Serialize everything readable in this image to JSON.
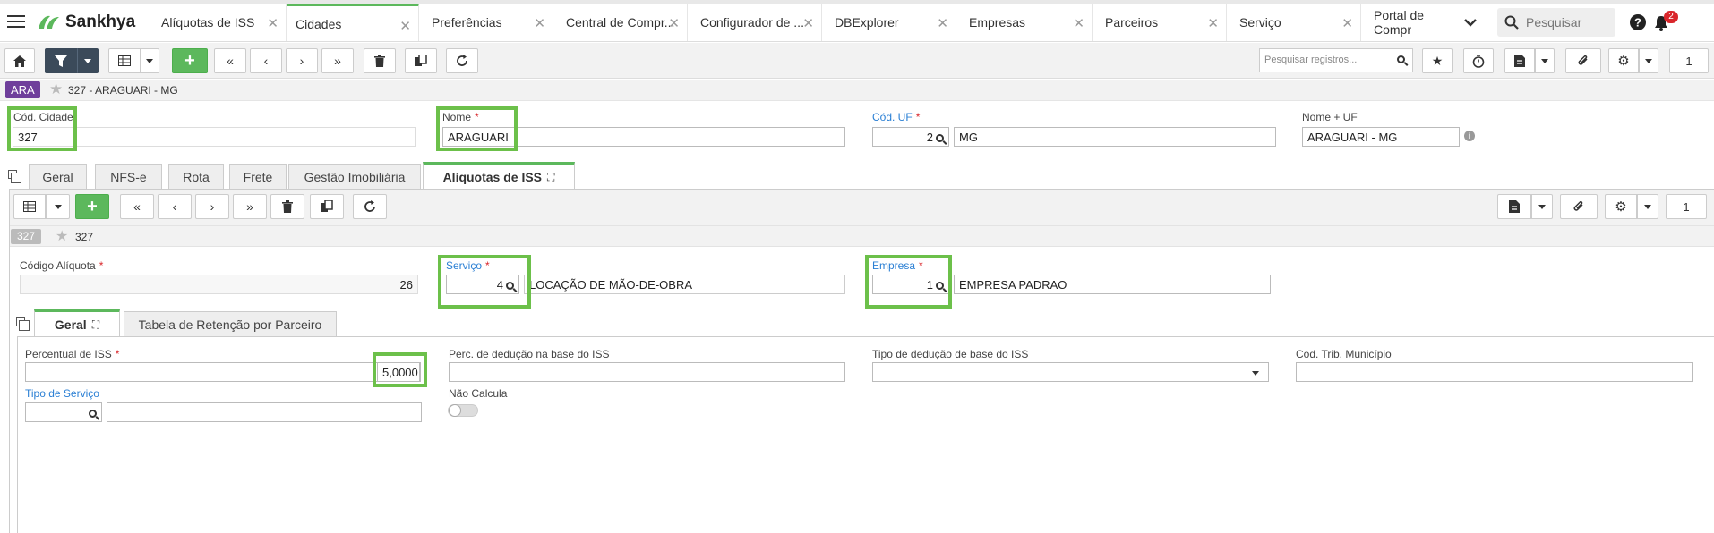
{
  "app": {
    "name": "Sankhya"
  },
  "tabs": [
    {
      "label": "Alíquotas de ISS"
    },
    {
      "label": "Cidades"
    },
    {
      "label": "Preferências"
    },
    {
      "label": "Central de Compr..."
    },
    {
      "label": "Configurador de ..."
    },
    {
      "label": "DBExplorer"
    },
    {
      "label": "Empresas"
    },
    {
      "label": "Parceiros"
    },
    {
      "label": "Serviço"
    },
    {
      "label": "Portal de Compr"
    }
  ],
  "global_search": {
    "placeholder": "Pesquisar"
  },
  "notifications": {
    "count": "2"
  },
  "toolbar": {
    "search_placeholder": "Pesquisar registros...",
    "page": "1"
  },
  "record": {
    "badge": "ARA",
    "title": "327 - ARAGUARI - MG"
  },
  "city": {
    "cod_label": "Cód. Cidade",
    "cod_value": "327",
    "nome_label": "Nome",
    "nome_value": "ARAGUARI",
    "uf_label": "Cód. UF",
    "uf_code": "2",
    "uf_value": "MG",
    "nomeuf_label": "Nome + UF",
    "nomeuf_value": "ARAGUARI - MG"
  },
  "form_tabs": [
    {
      "label": "Geral"
    },
    {
      "label": "NFS-e"
    },
    {
      "label": "Rota"
    },
    {
      "label": "Frete"
    },
    {
      "label": "Gestão Imobiliária"
    },
    {
      "label": "Alíquotas de ISS"
    }
  ],
  "sub": {
    "page": "1",
    "badge": "327",
    "title": "327",
    "codigo_label": "Código Alíquota",
    "codigo_value": "26",
    "servico_label": "Serviço",
    "servico_code": "4",
    "servico_desc": "LOCAÇÃO DE MÃO-DE-OBRA",
    "empresa_label": "Empresa",
    "empresa_code": "1",
    "empresa_desc": "EMPRESA PADRAO"
  },
  "inner_tabs": [
    {
      "label": "Geral"
    },
    {
      "label": "Tabela de Retenção por Parceiro"
    }
  ],
  "iss": {
    "perc_label": "Percentual de ISS",
    "perc_value": "5,0000",
    "deducao_label": "Perc. de dedução na base do ISS",
    "tipo_deducao_label": "Tipo de dedução de base do ISS",
    "cod_trib_label": "Cod. Trib. Município",
    "tipo_servico_label": "Tipo de Serviço",
    "nao_calcula_label": "Não Calcula",
    "nao_calcula_value": false
  },
  "colors": {
    "accent": "#5cb85c",
    "badge": "#6f3f9b",
    "link": "#2a7fd4",
    "highlight": "#6cc04a"
  }
}
